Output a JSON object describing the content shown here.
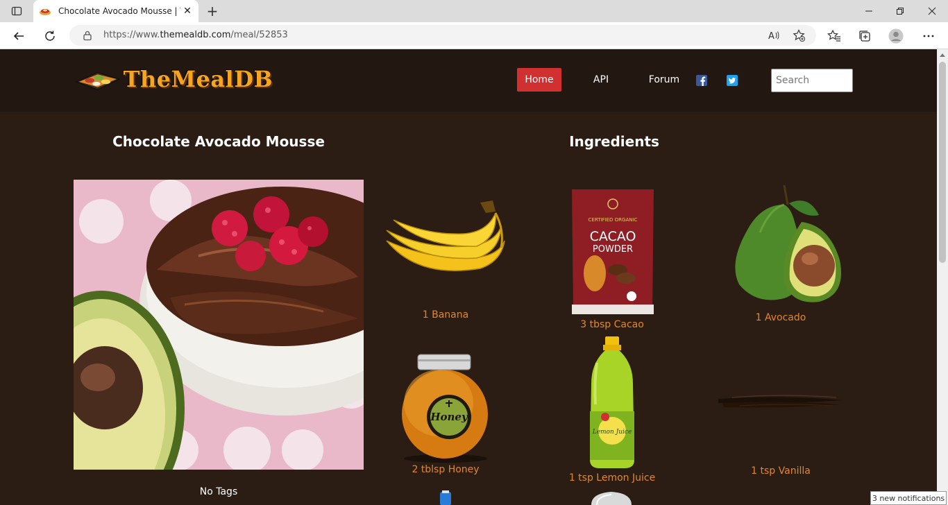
{
  "browser": {
    "tab_title": "Chocolate Avocado Mousse | The",
    "url_prefix": "https://www.",
    "url_domain": "themealdb.com",
    "url_path": "/meal/52853",
    "icons": {
      "tab_actions": "tab-actions-icon",
      "favicon": "favicon-icon",
      "close": "close-icon",
      "new_tab": "plus-icon",
      "minimize": "minimize-icon",
      "restore": "restore-icon",
      "window_close": "close-icon",
      "back": "back-arrow-icon",
      "refresh": "refresh-icon",
      "lock": "lock-icon",
      "read_aloud": "read-aloud-icon",
      "add_favorite": "star-add-icon",
      "favorites": "favorites-icon",
      "collections": "collections-icon",
      "profile": "avatar-icon",
      "more": "more-dots-icon"
    },
    "new_tab_glyph": "+",
    "close_glyph": "✕"
  },
  "site": {
    "logo_text": "TheMealDB",
    "nav": {
      "home": "Home",
      "api": "API",
      "forum": "Forum"
    },
    "search_placeholder": "Search",
    "colors": {
      "header_bg": "#231811",
      "page_bg": "#2b1d14",
      "home_active": "#d03030",
      "ingredient_label": "#e3872b",
      "facebook": "#3b5998",
      "twitter": "#1da1f2"
    }
  },
  "meal": {
    "title": "Chocolate Avocado Mousse",
    "tags_text": "No Tags"
  },
  "ingredients": {
    "heading": "Ingredients",
    "items": [
      {
        "label": "1 Banana",
        "icon": "banana-icon"
      },
      {
        "label": "3 tbsp Cacao",
        "icon": "cacao-powder-icon"
      },
      {
        "label": "1 Avocado",
        "icon": "avocado-icon"
      },
      {
        "label": "2 tblsp Honey",
        "icon": "honey-jar-icon"
      },
      {
        "label": "1 tsp Lemon Juice",
        "icon": "lemon-juice-bottle-icon"
      },
      {
        "label": "1 tsp Vanilla",
        "icon": "vanilla-pod-icon"
      }
    ]
  },
  "notification": "3 new notifications"
}
